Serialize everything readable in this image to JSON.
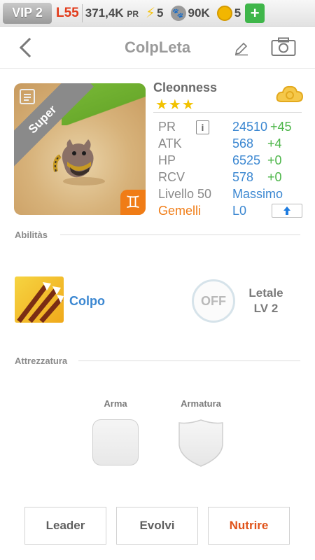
{
  "status": {
    "vip": "VIP 2",
    "level": "L55",
    "power_value": "371,4K",
    "power_unit": "PR",
    "energy": "5",
    "paws": "90K",
    "coins": "5",
    "plus": "+"
  },
  "header": {
    "title": "ColpLeta"
  },
  "card": {
    "rarity": "Super",
    "zodiac_symbol": "♊"
  },
  "info": {
    "name": "Cleonness",
    "stars": "★★★",
    "rows": [
      {
        "label": "PR",
        "value": "24510",
        "inc": "+45"
      },
      {
        "label": "ATK",
        "value": "568",
        "inc": "+4"
      },
      {
        "label": "HP",
        "value": "6525",
        "inc": "+0"
      },
      {
        "label": "RCV",
        "value": "578",
        "inc": "+0"
      },
      {
        "label": "Livello 50",
        "value": "Massimo"
      },
      {
        "label": "Gemelli",
        "value": "L0"
      }
    ],
    "info_button": "i"
  },
  "abilities": {
    "section_label": "Abilitàs",
    "skill_name": "Colpo",
    "off_label": "OFF",
    "passive_name": "Letale",
    "passive_level": "LV 2"
  },
  "equipment": {
    "section_label": "Attrezzatura",
    "weapon_label": "Arma",
    "armor_label": "Armatura"
  },
  "actions": {
    "leader": "Leader",
    "evolve": "Evolvi",
    "feed": "Nutrire"
  },
  "colors": {
    "accent_blue": "#3b87d1",
    "accent_green": "#4db64a",
    "accent_orange": "#e0531a",
    "level_red": "#e23b1b"
  }
}
